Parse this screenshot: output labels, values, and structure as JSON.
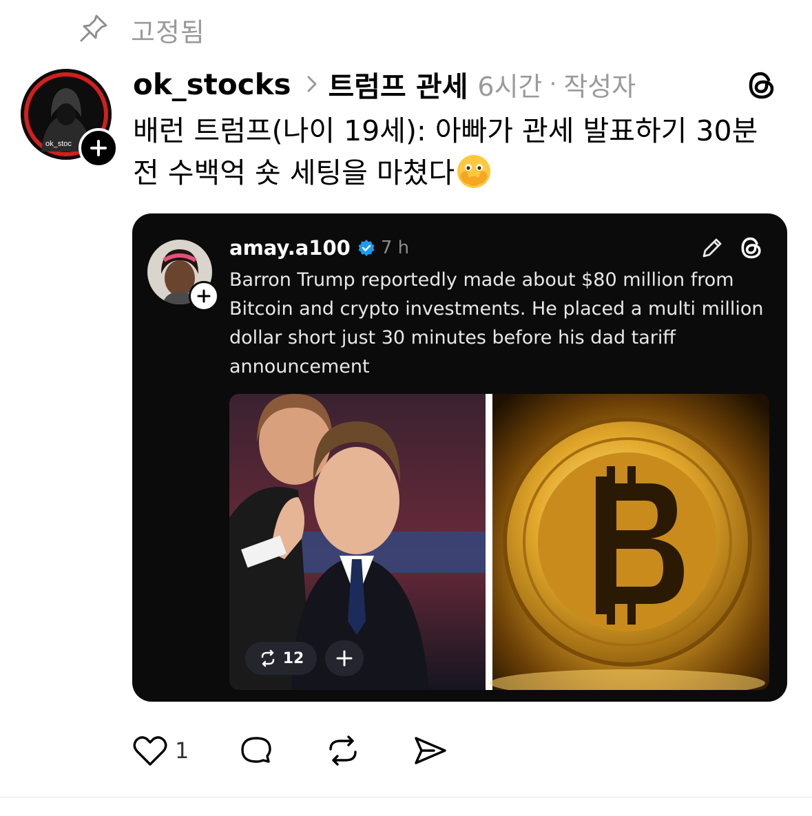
{
  "pinned": {
    "label": "고정됨",
    "icon": "pin-icon"
  },
  "post": {
    "username": "ok_stocks",
    "avatar_text": "ok_stoc",
    "topic": "트럼프 관세",
    "time": "6시간",
    "separator": "·",
    "author_tag": "작성자",
    "text": "배런 트럼프(나이 19세): 아빠가 관세 발표하기 30분 전 수백억 숏 세팅을 마쳤다",
    "emoji": "face-with-open-eyes-and-hand-over-mouth"
  },
  "quoted": {
    "username": "amay.a100",
    "verified": true,
    "time": "7 h",
    "text": "Barron Trump reportedly made about $80 million from Bitcoin and crypto investments. He placed a multi million dollar short just 30 minutes before his dad tariff announcement",
    "repost_count": "12",
    "images": [
      "person-in-suit-photo",
      "bitcoin-coin-photo"
    ]
  },
  "actions": {
    "like_count": "1",
    "icons": [
      "heart-icon",
      "comment-icon",
      "repost-icon",
      "share-icon"
    ]
  },
  "colors": {
    "muted": "#9a9a9a",
    "card_bg": "#0b0b0b",
    "verified_blue": "#1d9bf0",
    "bitcoin_gold": "#d4a017"
  }
}
